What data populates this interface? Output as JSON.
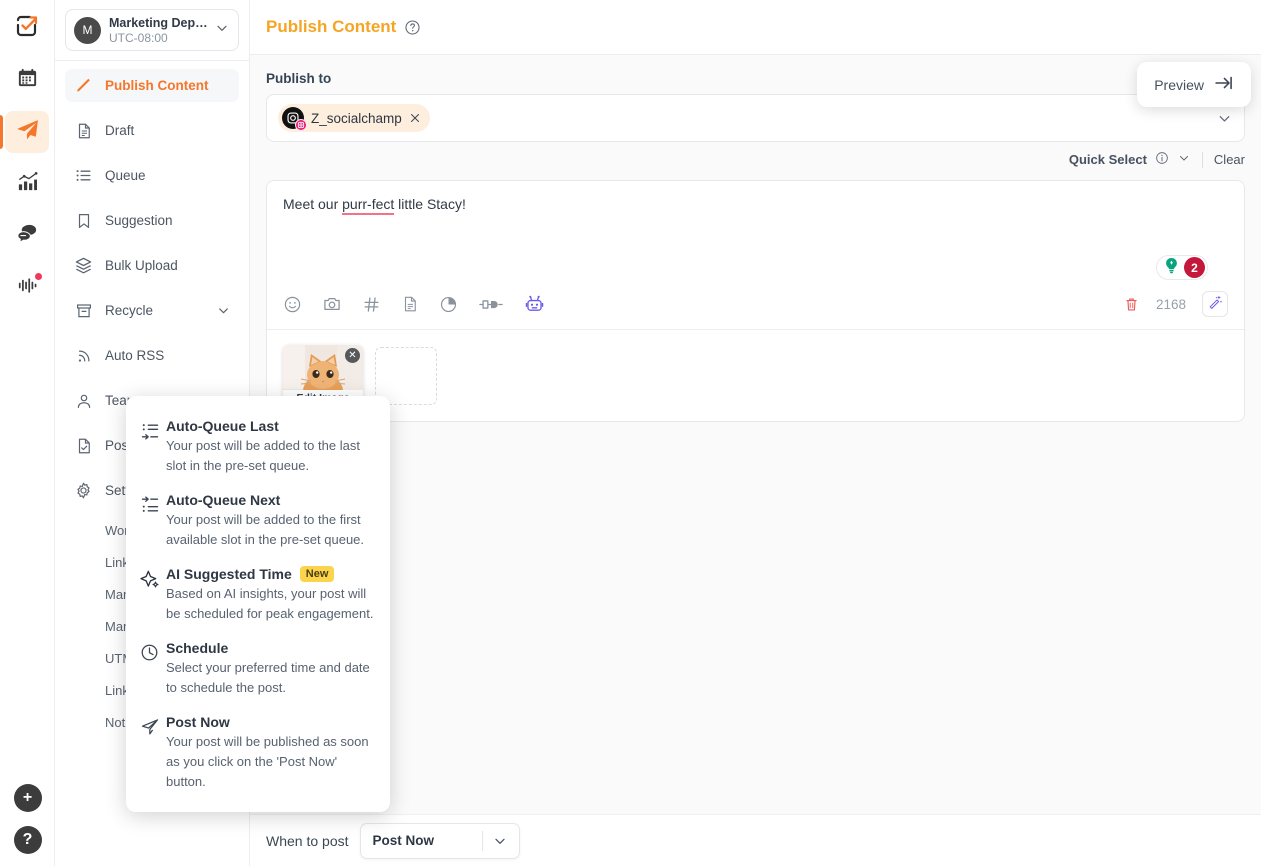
{
  "rail": {
    "items": [
      {
        "name": "logo",
        "icon": "checkbox-arrow-logo"
      },
      {
        "name": "calendar",
        "icon": "calendar-icon"
      },
      {
        "name": "publish",
        "icon": "paper-plane-icon",
        "active": true
      },
      {
        "name": "analytics",
        "icon": "bar-chart-icon"
      },
      {
        "name": "inbox",
        "icon": "chat-bubbles-icon"
      },
      {
        "name": "monitor",
        "icon": "waveform-icon",
        "badge": true
      }
    ],
    "bottom": [
      {
        "name": "add",
        "label": "+"
      },
      {
        "name": "help",
        "label": "?"
      }
    ]
  },
  "workspace": {
    "avatar_initial": "M",
    "name": "Marketing Departm...",
    "timezone": "UTC-08:00"
  },
  "sidebar": {
    "items": [
      {
        "label": "Publish Content",
        "icon": "pencil-icon",
        "active": true
      },
      {
        "label": "Draft",
        "icon": "document-icon"
      },
      {
        "label": "Queue",
        "icon": "list-icon"
      },
      {
        "label": "Suggestion",
        "icon": "bookmark-icon"
      },
      {
        "label": "Bulk Upload",
        "icon": "layers-icon"
      },
      {
        "label": "Recycle",
        "icon": "archive-icon",
        "chevron": "down"
      },
      {
        "label": "Auto RSS",
        "icon": "rss-icon"
      },
      {
        "label": "Team",
        "icon": "user-icon"
      },
      {
        "label": "Post Approval",
        "icon": "document-check-icon"
      },
      {
        "label": "Settings",
        "icon": "gear-icon",
        "chevron": "right"
      }
    ],
    "subitems": [
      {
        "label": "Workspace"
      },
      {
        "label": "Link Shortening"
      },
      {
        "label": "Manage Queue"
      },
      {
        "label": "Manage Account"
      },
      {
        "label": "UTM Tracking"
      },
      {
        "label": "Link in bio"
      },
      {
        "label": "Notifications"
      }
    ],
    "collapse_label": "collapse-sidebar"
  },
  "header": {
    "title": "Publish Content",
    "help_icon": "question-circle-icon",
    "preview_label": "Preview",
    "preview_icon": "arrow-to-right-icon"
  },
  "publish": {
    "label": "Publish to",
    "account": {
      "name": "Z_socialchamp",
      "network": "instagram",
      "remove_icon": "close-icon"
    },
    "dropdown_icon": "chevron-down-icon",
    "quick_select": "Quick Select",
    "quick_select_info_icon": "info-icon",
    "quick_select_chevron": "chevron-down-icon",
    "clear": "Clear"
  },
  "editor": {
    "text_prefix": "Meet our ",
    "text_misspelled": "purr-fect",
    "text_suffix": " little Stacy!",
    "idea_icon": "lightbulb-icon",
    "idea_count": "2",
    "char_count": "2168",
    "delete_icon": "trash-icon",
    "wand_icon": "magic-wand-icon",
    "toolbar_icons": [
      "emoji-icon",
      "camera-icon",
      "hashtag-icon",
      "document-icon",
      "pie-chart-icon",
      "plug-icon",
      "robot-icon"
    ],
    "media": {
      "thumb_alt": "orange-kitten-photo",
      "edit_label": "Edit Image",
      "remove_icon": "close-icon"
    }
  },
  "schedule_menu": {
    "items": [
      {
        "title": "Auto-Queue Last",
        "desc": "Your post will be added to the last slot in the pre-set queue.",
        "icon": "queue-last-icon"
      },
      {
        "title": "Auto-Queue Next",
        "desc": "Your post will be added to the first available slot in the pre-set queue.",
        "icon": "queue-next-icon"
      },
      {
        "title": "AI Suggested Time",
        "badge": "New",
        "desc": "Based on AI insights, your post will be scheduled for peak engagement.",
        "icon": "sparkle-icon"
      },
      {
        "title": "Schedule",
        "desc": "Select your preferred time and date to schedule the post.",
        "icon": "clock-icon"
      },
      {
        "title": "Post Now",
        "desc": "Your post will be published as soon as you click on the 'Post Now' button.",
        "icon": "send-icon"
      }
    ]
  },
  "footer": {
    "when_label": "When to post",
    "when_value": "Post Now",
    "chevron_icon": "chevron-down-icon"
  },
  "colors": {
    "accent_orange": "#f4772b",
    "title_yellow": "#f5a524",
    "badge_red": "#c4173c",
    "badge_yellow": "#fbd44c",
    "purple": "#6b5ce7",
    "teal": "#0aa37f",
    "pink": "#e6187f"
  }
}
